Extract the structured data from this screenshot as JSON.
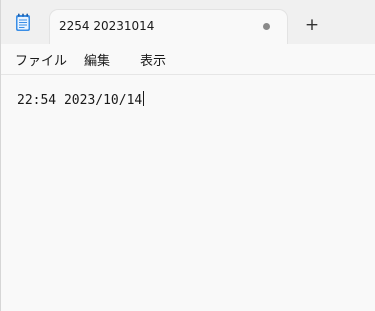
{
  "tab": {
    "title": "2254 20231014"
  },
  "menu": {
    "items": [
      "ファイル",
      "編集",
      "表示"
    ]
  },
  "editor": {
    "content": "22:54 2023/10/14"
  },
  "icons": {
    "app": "notepad-icon",
    "unsaved": "unsaved-dot-icon",
    "new_tab": "plus-icon"
  },
  "colors": {
    "titlebar_bg": "#f0f0f0",
    "content_bg": "#f9f9f9",
    "notepad_icon_blue": "#3a8ee6"
  }
}
